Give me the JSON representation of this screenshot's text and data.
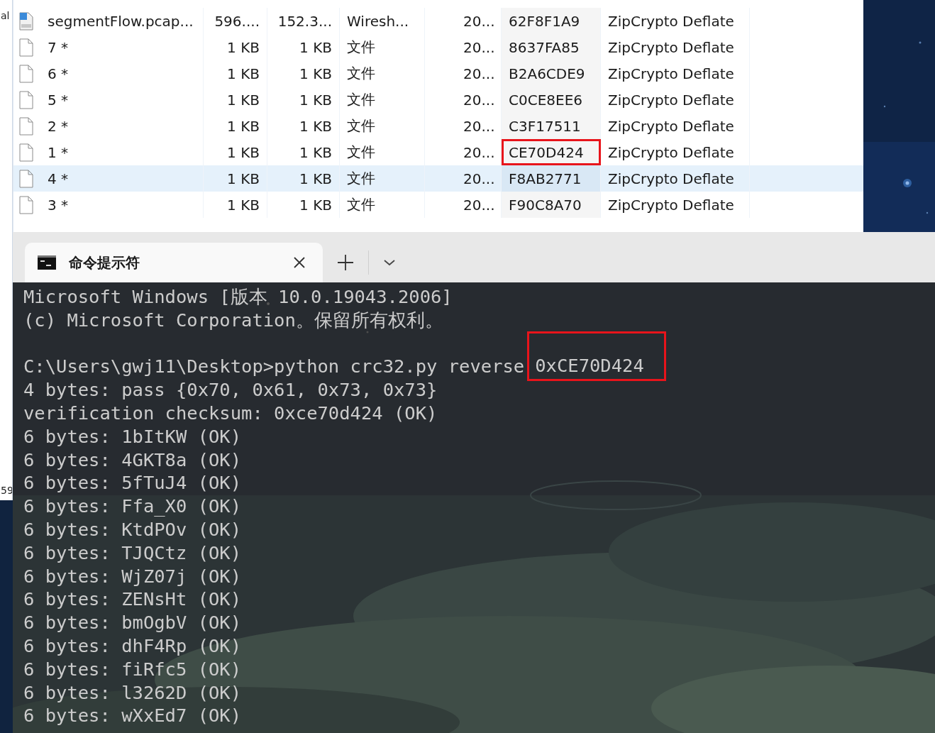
{
  "edge_texts": [
    "al",
    "59"
  ],
  "explorer": {
    "rows": [
      {
        "kind": "pcap",
        "name": "segmentFlow.pcap...",
        "size": "596....",
        "compressed": "152.3...",
        "type": "Wiresh...",
        "date": "20...",
        "crc": "62F8F1A9",
        "method": "ZipCrypto Deflate",
        "selected": false,
        "highlighted": false
      },
      {
        "kind": "file",
        "name": "7 *",
        "size": "1 KB",
        "compressed": "1 KB",
        "type": "文件",
        "date": "20...",
        "crc": "8637FA85",
        "method": "ZipCrypto Deflate",
        "selected": false,
        "highlighted": false
      },
      {
        "kind": "file",
        "name": "6 *",
        "size": "1 KB",
        "compressed": "1 KB",
        "type": "文件",
        "date": "20...",
        "crc": "B2A6CDE9",
        "method": "ZipCrypto Deflate",
        "selected": false,
        "highlighted": false
      },
      {
        "kind": "file",
        "name": "5 *",
        "size": "1 KB",
        "compressed": "1 KB",
        "type": "文件",
        "date": "20...",
        "crc": "C0CE8EE6",
        "method": "ZipCrypto Deflate",
        "selected": false,
        "highlighted": false
      },
      {
        "kind": "file",
        "name": "2 *",
        "size": "1 KB",
        "compressed": "1 KB",
        "type": "文件",
        "date": "20...",
        "crc": "C3F17511",
        "method": "ZipCrypto Deflate",
        "selected": false,
        "highlighted": false
      },
      {
        "kind": "file",
        "name": "1 *",
        "size": "1 KB",
        "compressed": "1 KB",
        "type": "文件",
        "date": "20...",
        "crc": "CE70D424",
        "method": "ZipCrypto Deflate",
        "selected": false,
        "highlighted": true
      },
      {
        "kind": "file",
        "name": "4 *",
        "size": "1 KB",
        "compressed": "1 KB",
        "type": "文件",
        "date": "20...",
        "crc": "F8AB2771",
        "method": "ZipCrypto Deflate",
        "selected": true,
        "highlighted": false
      },
      {
        "kind": "file",
        "name": "3 *",
        "size": "1 KB",
        "compressed": "1 KB",
        "type": "文件",
        "date": "20...",
        "crc": "F90C8A70",
        "method": "ZipCrypto Deflate",
        "selected": false,
        "highlighted": false
      }
    ]
  },
  "terminal": {
    "tab": {
      "title": "命令提示符",
      "selected": true
    },
    "lines": [
      {
        "kind": "text",
        "text": "Microsoft Windows [版本 10.0.19043.2006]"
      },
      {
        "kind": "text",
        "text": "(c) Microsoft Corporation。保留所有权利。"
      },
      {
        "kind": "blank"
      },
      {
        "kind": "command",
        "text": "C:\\Users\\gwj11\\Desktop>python crc32.py reverse",
        "highlight": "0xCE70D424"
      },
      {
        "kind": "text",
        "text": "4 bytes: pass {0x70, 0x61, 0x73, 0x73}"
      },
      {
        "kind": "text",
        "text": "verification checksum: 0xce70d424 (OK)"
      },
      {
        "kind": "text",
        "text": "6 bytes: 1bItKW (OK)"
      },
      {
        "kind": "text",
        "text": "6 bytes: 4GKT8a (OK)"
      },
      {
        "kind": "text",
        "text": "6 bytes: 5fTuJ4 (OK)"
      },
      {
        "kind": "text",
        "text": "6 bytes: Ffa_X0 (OK)"
      },
      {
        "kind": "text",
        "text": "6 bytes: KtdPOv (OK)"
      },
      {
        "kind": "text",
        "text": "6 bytes: TJQCtz (OK)"
      },
      {
        "kind": "text",
        "text": "6 bytes: WjZ07j (OK)"
      },
      {
        "kind": "text",
        "text": "6 bytes: ZENsHt (OK)"
      },
      {
        "kind": "text",
        "text": "6 bytes: bmOgbV (OK)"
      },
      {
        "kind": "text",
        "text": "6 bytes: dhF4Rp (OK)"
      },
      {
        "kind": "text",
        "text": "6 bytes: fiRfc5 (OK)"
      },
      {
        "kind": "text",
        "text": "6 bytes: l3262D (OK)"
      },
      {
        "kind": "text",
        "text": "6 bytes: wXxEd7 (OK)"
      }
    ]
  }
}
